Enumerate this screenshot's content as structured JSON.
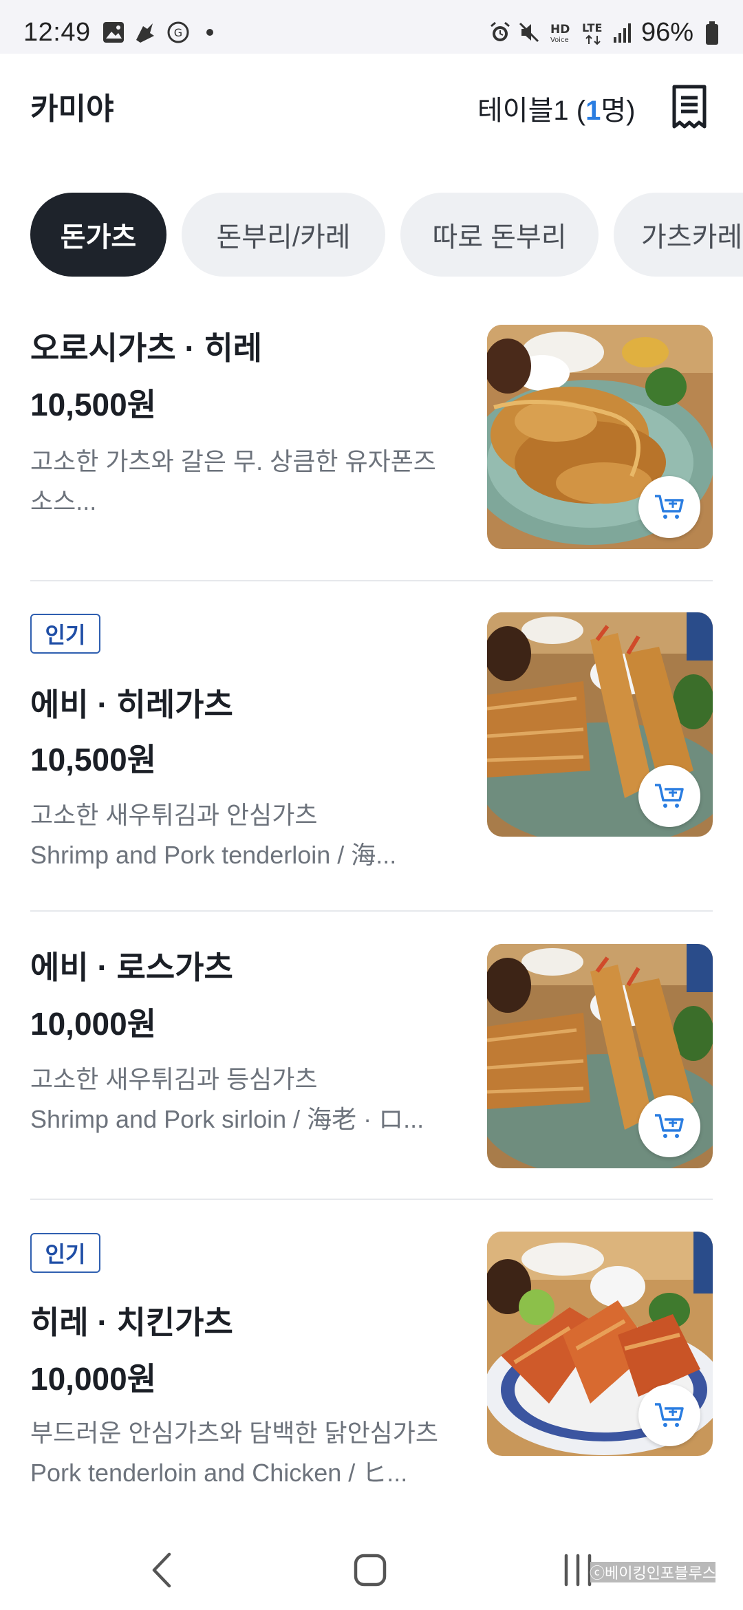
{
  "status_bar": {
    "time": "12:49",
    "battery": "96%",
    "network": "LTE",
    "voice": "HD",
    "icons": [
      "gallery-icon",
      "app-icon",
      "app-icon",
      "dot-icon",
      "alarm-icon",
      "mute-icon",
      "hd-voice-icon",
      "lte-icon",
      "signal-icon",
      "battery-icon"
    ]
  },
  "header": {
    "store_name": "카미야",
    "table_label": "테이블1 (",
    "table_count": "1",
    "table_suffix": "명)",
    "receipt_icon": "receipt-icon"
  },
  "tabs": [
    {
      "label": "돈가츠",
      "active": true
    },
    {
      "label": "돈부리/카레",
      "active": false
    },
    {
      "label": "따로 돈부리",
      "active": false
    },
    {
      "label": "가츠카레",
      "active": false
    }
  ],
  "menu": [
    {
      "name": "오로시가츠 · 히레",
      "price": "10,500원",
      "desc": [
        "고소한 가츠와 갈은 무. 상큼한 유자폰즈",
        "소스..."
      ]
    },
    {
      "badge": "인기",
      "name": "에비 · 히레가츠",
      "price": "10,500원",
      "desc": [
        "고소한 새우튀김과 안심가츠",
        "Shrimp and Pork tenderloin / 海..."
      ]
    },
    {
      "name": "에비 · 로스가츠",
      "price": "10,000원",
      "desc": [
        "고소한 새우튀김과 등심가츠",
        "Shrimp and Pork sirloin / 海老 · ロ..."
      ]
    },
    {
      "badge": "인기",
      "name": "히레 · 치킨가츠",
      "price": "10,000원",
      "desc": [
        "부드러운 안심가츠와 담백한 닭안심가츠",
        "Pork tenderloin and Chicken / ヒ..."
      ]
    }
  ],
  "nav": {
    "back_icon": "back-icon",
    "home_icon": "home-icon",
    "recents_icon": "recents-icon"
  },
  "watermark": "ⓒ베이킹인포블루스",
  "colors": {
    "accent": "#2a7de1",
    "tab_active": "#1e232b",
    "badge": "#1f4ea6"
  }
}
